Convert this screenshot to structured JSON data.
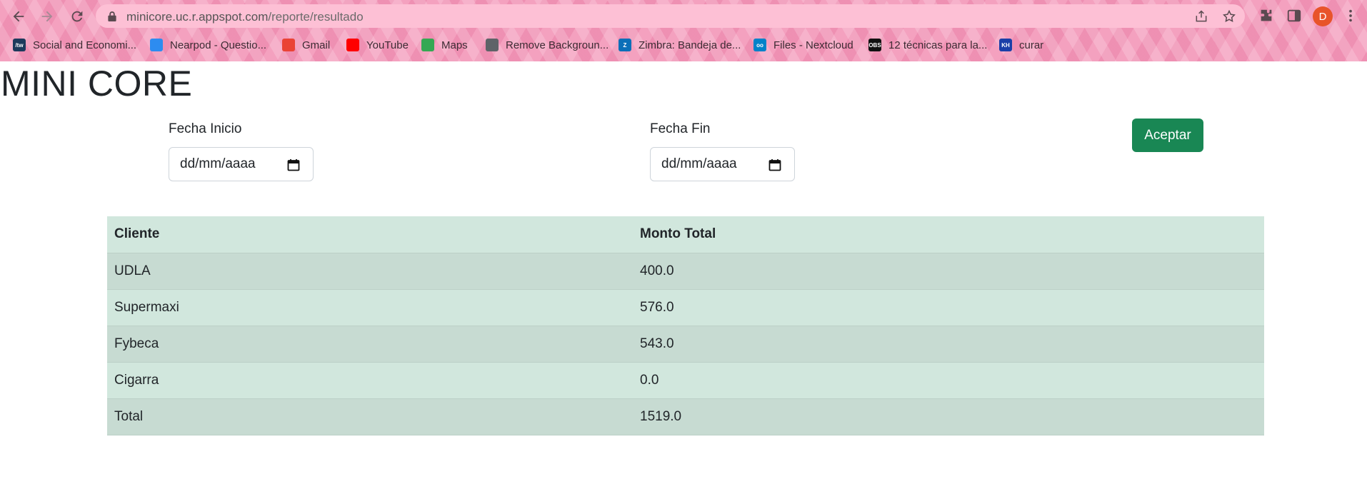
{
  "browser": {
    "url_host": "minicore.uc.r.appspot.com",
    "url_path": "/reporte/resultado",
    "profile_initial": "D",
    "bookmarks": [
      {
        "label": "Social and Economi...",
        "icon": "tw-icon",
        "color": "#1d3a5c",
        "glyph": "/tw"
      },
      {
        "label": "Nearpod - Questio...",
        "icon": "nearpod-icon",
        "color": "#2d8cf0",
        "glyph": ""
      },
      {
        "label": "Gmail",
        "icon": "gmail-icon",
        "color": "#ea4335",
        "glyph": ""
      },
      {
        "label": "YouTube",
        "icon": "youtube-icon",
        "color": "#ff0000",
        "glyph": ""
      },
      {
        "label": "Maps",
        "icon": "maps-icon",
        "color": "#34a853",
        "glyph": ""
      },
      {
        "label": "Remove Backgroun...",
        "icon": "remove-bg-icon",
        "color": "#5f6368",
        "glyph": ""
      },
      {
        "label": "Zimbra: Bandeja de...",
        "icon": "zimbra-icon",
        "color": "#0b6fb8",
        "glyph": "Z"
      },
      {
        "label": "Files - Nextcloud",
        "icon": "nextcloud-icon",
        "color": "#0082c9",
        "glyph": "oo"
      },
      {
        "label": "12 técnicas para la...",
        "icon": "obs-icon",
        "color": "#111111",
        "glyph": "OBS"
      },
      {
        "label": "curar",
        "icon": "kh-icon",
        "color": "#1a3fa8",
        "glyph": "KH"
      }
    ]
  },
  "page": {
    "title": "MINI CORE"
  },
  "filters": {
    "start_label": "Fecha Inicio",
    "start_value": "dd/mm/aaaa",
    "end_label": "Fecha Fin",
    "end_value": "dd/mm/aaaa",
    "accept_label": "Aceptar"
  },
  "table": {
    "headers": [
      "Cliente",
      "Monto Total"
    ],
    "rows": [
      [
        "UDLA",
        "400.0"
      ],
      [
        "Supermaxi",
        "576.0"
      ],
      [
        "Fybeca",
        "543.0"
      ],
      [
        "Cigarra",
        "0.0"
      ],
      [
        "Total",
        "1519.0"
      ]
    ]
  },
  "colors": {
    "accent_button": "#198754",
    "table_bg": "#d1e7dd",
    "table_striped": "#c7dbd2",
    "chrome_bg": "#f4a1bf",
    "avatar": "#e8542a"
  }
}
